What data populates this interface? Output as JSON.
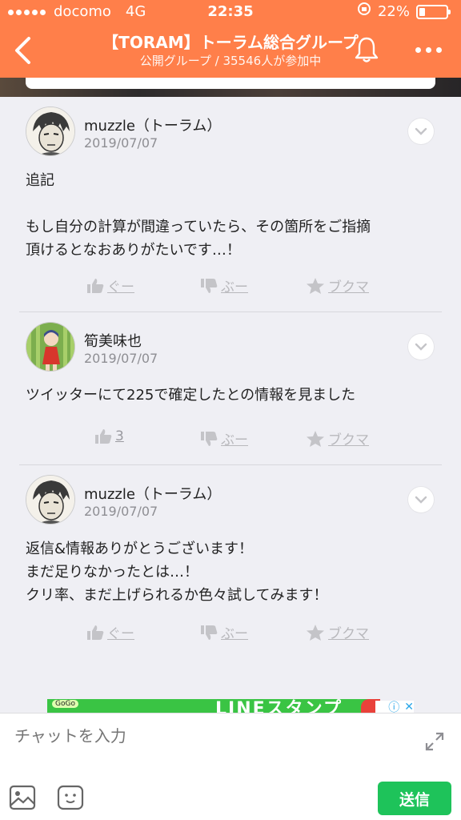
{
  "status_bar": {
    "carrier": "docomo",
    "network": "4G",
    "time": "22:35",
    "battery": "22%",
    "battery_level": 0.22
  },
  "nav": {
    "title": "【TORAM】トーラム総合グループ",
    "subtitle": "公開グループ / 35546人が参加中"
  },
  "comments": [
    {
      "author": "muzzle（トーラム）",
      "date": "2019/07/07",
      "body": "追記\n\nもし自分の計算が間違っていたら、その箇所をご指摘\n頂けるとなおありがたいです…！",
      "good_label": "ぐー",
      "bad_label": "ぶー",
      "bookmark_label": "ブクマ"
    },
    {
      "author": "筍美味也",
      "date": "2019/07/07",
      "body": "ツイッターにて225で確定したとの情報を見ました",
      "good_label": "3",
      "bad_label": "ぶー",
      "bookmark_label": "ブクマ"
    },
    {
      "author": "muzzle（トーラム）",
      "date": "2019/07/07",
      "body": "返信&情報ありがとうございます！\nまだ足りなかったとは…！\nクリ率、まだ上げられるか色々試してみます！",
      "good_label": "ぐー",
      "bad_label": "ぶー",
      "bookmark_label": "ブクマ"
    }
  ],
  "ad": {
    "banner_text": "LINEスタンプ"
  },
  "input": {
    "placeholder": "チャットを入力",
    "send_label": "送信"
  },
  "colors": {
    "header": "#ff7f4a",
    "send": "#1ec35a",
    "muted": "#b8b8bc"
  }
}
